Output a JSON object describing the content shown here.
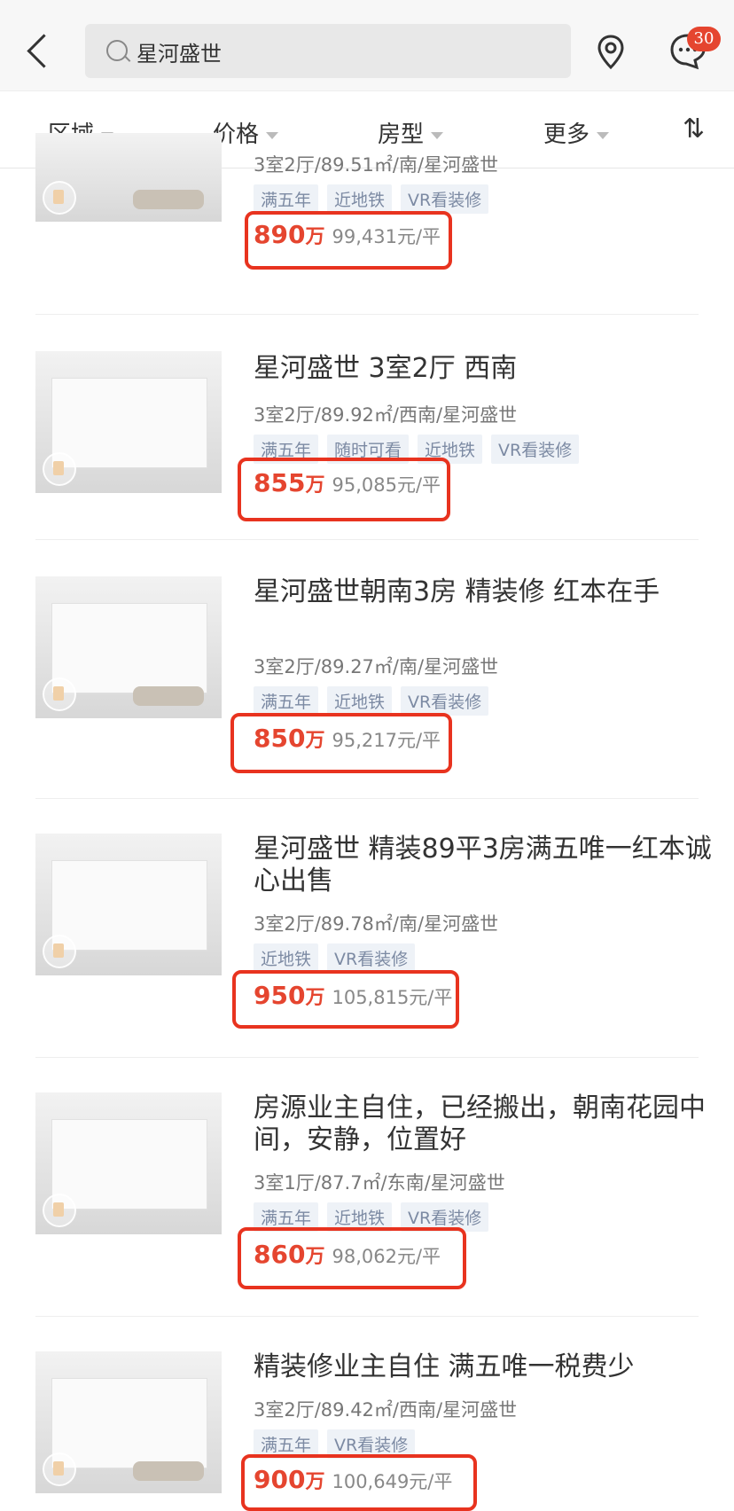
{
  "search": {
    "query": "星河盛世"
  },
  "header": {
    "badge_count": "30"
  },
  "filters": {
    "area": "区域",
    "price": "价格",
    "layout": "房型",
    "more": "更多",
    "sort": "⇅"
  },
  "listings": [
    {
      "title": "",
      "sub": "3室2厅/89.51㎡/南/星河盛世",
      "tags": [
        "满五年",
        "近地铁",
        "VR看装修"
      ],
      "price": "890",
      "unit": "万",
      "per": "99,431元/平"
    },
    {
      "title": "星河盛世 3室2厅 西南",
      "sub": "3室2厅/89.92㎡/西南/星河盛世",
      "tags": [
        "满五年",
        "随时可看",
        "近地铁",
        "VR看装修"
      ],
      "price": "855",
      "unit": "万",
      "per": "95,085元/平"
    },
    {
      "title": "星河盛世朝南3房 精装修 红本在手",
      "sub": "3室2厅/89.27㎡/南/星河盛世",
      "tags": [
        "满五年",
        "近地铁",
        "VR看装修"
      ],
      "price": "850",
      "unit": "万",
      "per": "95,217元/平"
    },
    {
      "title": "星河盛世 精装89平3房满五唯一红本诚心出售",
      "sub": "3室2厅/89.78㎡/南/星河盛世",
      "tags": [
        "近地铁",
        "VR看装修"
      ],
      "price": "950",
      "unit": "万",
      "per": "105,815元/平"
    },
    {
      "title": "房源业主自住，已经搬出，朝南花园中间，安静，位置好",
      "sub": "3室1厅/87.7㎡/东南/星河盛世",
      "tags": [
        "满五年",
        "近地铁",
        "VR看装修"
      ],
      "price": "860",
      "unit": "万",
      "per": "98,062元/平"
    },
    {
      "title": "精装修业主自住 满五唯一税费少",
      "sub": "3室2厅/89.42㎡/西南/星河盛世",
      "tags": [
        "满五年",
        "VR看装修"
      ],
      "price": "900",
      "unit": "万",
      "per": "100,649元/平"
    }
  ],
  "colors": {
    "accent": "#e5452f",
    "highlight_box": "#e8331f"
  }
}
